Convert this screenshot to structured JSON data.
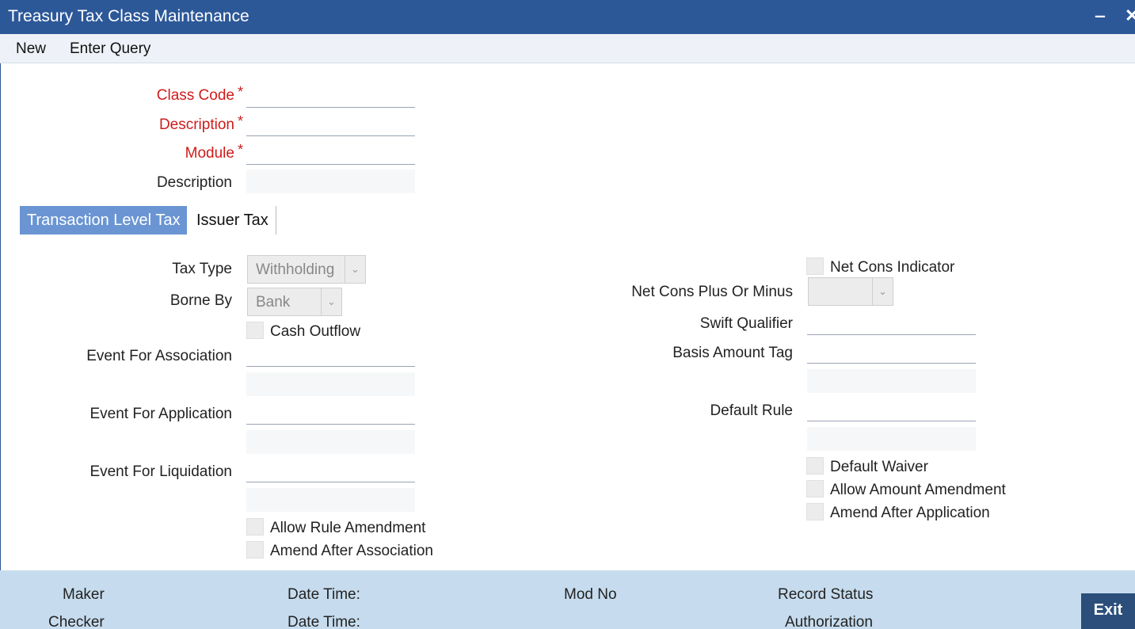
{
  "window": {
    "title": "Treasury Tax Class Maintenance",
    "minimize_glyph": "‒",
    "close_glyph": "✕"
  },
  "menu": {
    "new_label": "New",
    "enter_query_label": "Enter Query"
  },
  "header_form": {
    "class_code_label": "Class Code",
    "description_label": "Description",
    "module_label": "Module",
    "module_description_label": "Description",
    "required_marker": "*",
    "class_code_value": "",
    "description_value": "",
    "module_value": "",
    "module_description_value": ""
  },
  "tabs": [
    {
      "label": "Transaction Level Tax",
      "active": true
    },
    {
      "label": "Issuer Tax",
      "active": false
    }
  ],
  "left_form": {
    "tax_type_label": "Tax Type",
    "tax_type_value": "Withholding",
    "borne_by_label": "Borne By",
    "borne_by_value": "Bank",
    "cash_outflow_label": "Cash Outflow",
    "event_association_label": "Event For Association",
    "event_application_label": "Event For Application",
    "event_liquidation_label": "Event For Liquidation",
    "allow_rule_amendment_label": "Allow Rule Amendment",
    "amend_after_association_label": "Amend After Association"
  },
  "right_form": {
    "net_cons_indicator_label": "Net Cons Indicator",
    "net_cons_plus_minus_label": "Net Cons Plus Or Minus",
    "net_cons_plus_minus_value": "",
    "swift_qualifier_label": "Swift Qualifier",
    "basis_amount_tag_label": "Basis Amount Tag",
    "default_rule_label": "Default Rule",
    "default_waiver_label": "Default Waiver",
    "allow_amount_amendment_label": "Allow Amount Amendment",
    "amend_after_application_label": "Amend After Application"
  },
  "footer": {
    "maker_label": "Maker",
    "checker_label": "Checker",
    "date_time_label_1": "Date Time:",
    "date_time_label_2": "Date Time:",
    "mod_no_label": "Mod No",
    "record_status_label": "Record Status",
    "authorization_label": "Authorization",
    "exit_label": "Exit"
  },
  "colors": {
    "titlebar": "#2c5898",
    "active_tab": "#6a95d2",
    "required_label": "#d01b1b",
    "footer": "#c6dcee",
    "exit_button": "#2b4f7a"
  }
}
